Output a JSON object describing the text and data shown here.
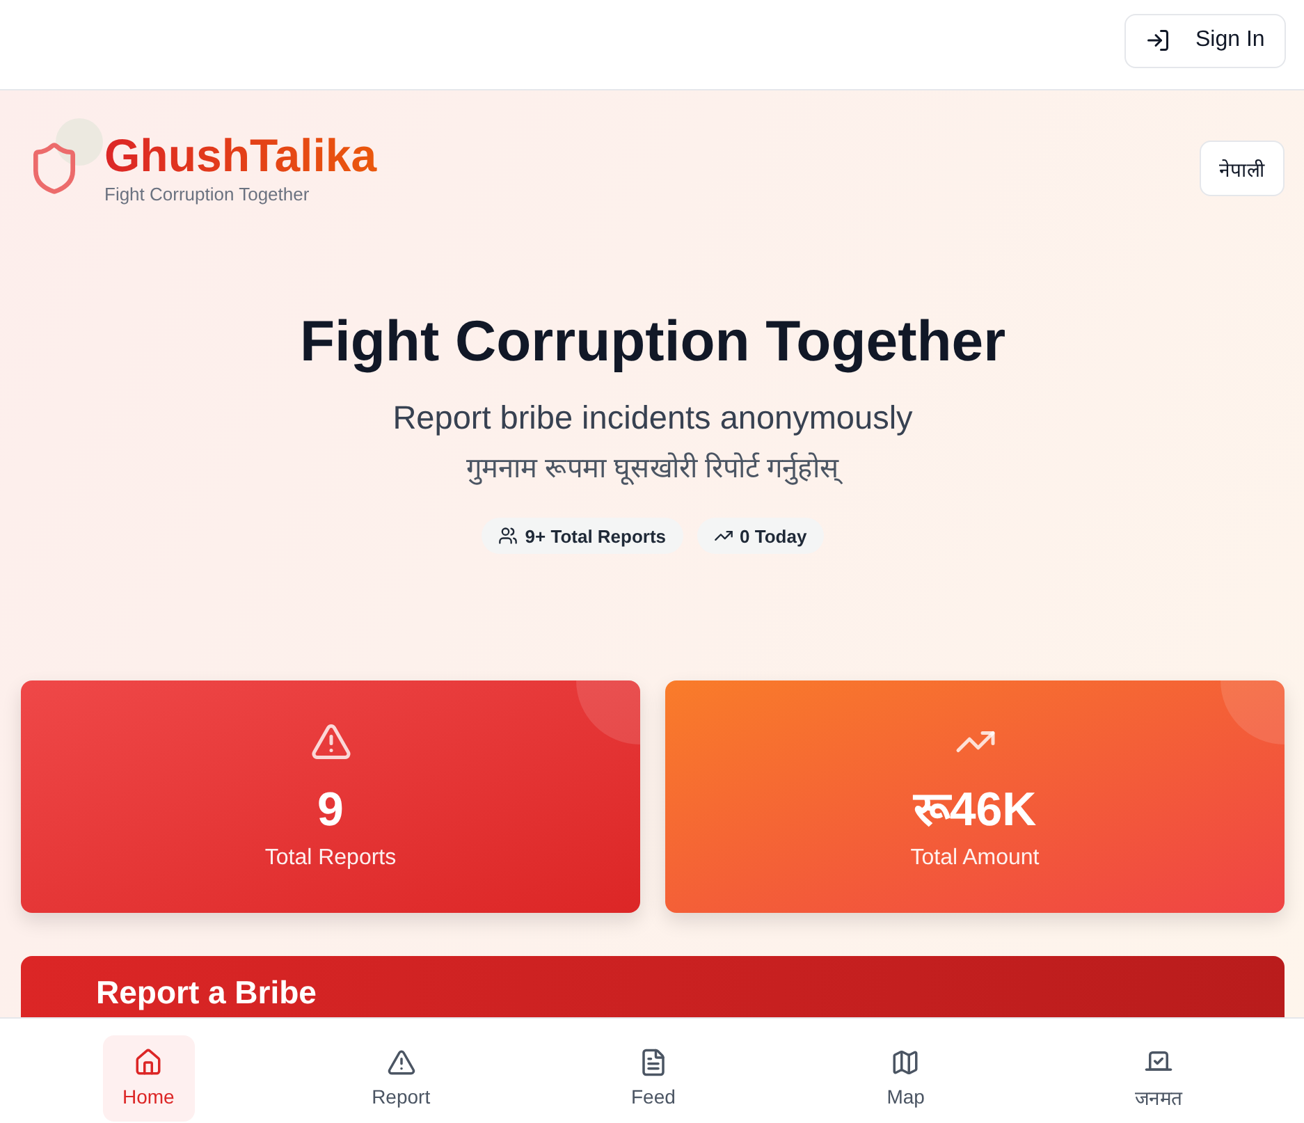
{
  "header": {
    "sign_in": "Sign In"
  },
  "brand": {
    "name": "GhushTalika",
    "tagline": "Fight Corruption Together",
    "language_button": "नेपाली"
  },
  "hero": {
    "title": "Fight Corruption Together",
    "subtitle": "Report bribe incidents anonymously",
    "subtitle_nepali": "गुमनाम रूपमा घूसखोरी रिपोर्ट गर्नुहोस्",
    "badges": [
      {
        "kind": "users",
        "label": "9+ Total Reports"
      },
      {
        "kind": "trend",
        "label": "0 Today"
      }
    ]
  },
  "stats": [
    {
      "kind": "reports",
      "value": "9",
      "label": "Total Reports"
    },
    {
      "kind": "amount",
      "value": "रू46K",
      "label": "Total Amount"
    }
  ],
  "report_card": {
    "title": "Report a Bribe"
  },
  "bottom_nav": [
    {
      "kind": "home",
      "label": "Home",
      "selected": true
    },
    {
      "kind": "report",
      "label": "Report",
      "selected": false
    },
    {
      "kind": "feed",
      "label": "Feed",
      "selected": false
    },
    {
      "kind": "map",
      "label": "Map",
      "selected": false
    },
    {
      "kind": "poll",
      "label": "जनमत",
      "selected": false
    }
  ]
}
